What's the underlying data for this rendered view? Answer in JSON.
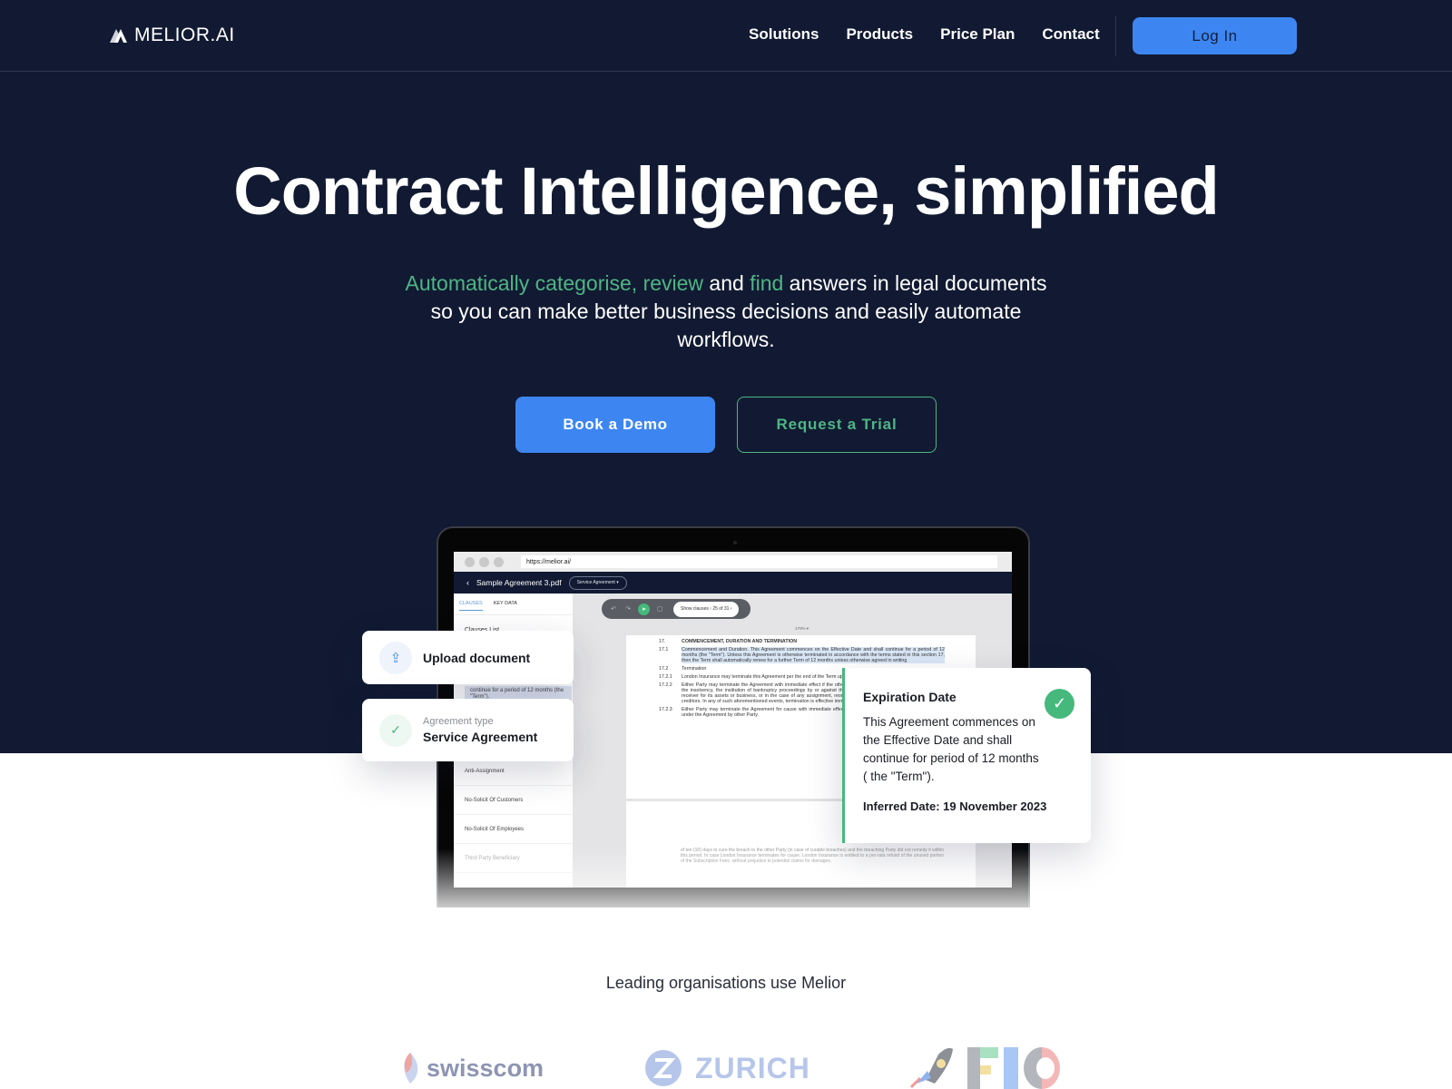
{
  "nav": {
    "brand": "MELIOR.AI",
    "links": [
      "Solutions",
      "Products",
      "Price Plan",
      "Contact"
    ],
    "login_label": "Log In"
  },
  "hero": {
    "title": "Contract Intelligence, simplified",
    "subtitle": {
      "hl1": "Automatically categorise, review",
      "t1": " and ",
      "hl2": "find",
      "t2": " answers in legal documents so you can make better business decisions and easily automate workflows."
    },
    "primary_cta": "Book a Demo",
    "secondary_cta": "Request a Trial"
  },
  "mockup": {
    "url": "https://melior.ai/",
    "doc_name": "Sample Agreement 3.pdf",
    "agreement_select": "Service Agreement",
    "tabs": [
      "CLAUSES",
      "KEY DATA"
    ],
    "clauses_heading": "Clauses List",
    "clause_snippet": "continue for a period of 12 months (the \"Term\").",
    "clauses": [
      "Anti-Assignment",
      "No-Solicit Of Customers",
      "No-Solicit Of Employees",
      "Third Party Beneficiary"
    ],
    "toolbar": {
      "show_clauses": "Show clauses",
      "counter": "25 of 31"
    },
    "zoom_level": "170% ▾",
    "document": [
      {
        "num": "17.",
        "text": "COMMENCEMENT, DURATION AND TERMINATION",
        "bold": true
      },
      {
        "num": "17.1",
        "text": "Commencement and Duration. This Agreement commences on the Effective Date and shall continue for a period of 12 months (the \"Term\"). Unless this Agreement is otherwise terminated in accordance with the terms stated in this section 17, then the Term shall automatically renew for a further Term of 12 months unless otherwise agreed in writing",
        "highlight": true
      },
      {
        "num": "17.2",
        "text": "Termination"
      },
      {
        "num": "17.2.1",
        "text": "London Insurance may terminate this Agreement per the end of the Term upon 30 day notice period."
      },
      {
        "num": "17.2.2",
        "text": "Either Party may terminate the Agreement with immediate effect if the other Party ceases its business by the other Party, the insolvency, the institution of bankruptcy proceedings by or against the other Party, the appointment of a trustee or receiver for its assets or business, or in the case of any assignment, reorganization or arrangement for the benefit of its creditors. In any of such aforementioned events, termination is effective immediately."
      },
      {
        "num": "17.2.3",
        "text": "Either Party may terminate the Agreement for cause with immediate effect in case of a material breach of an obligation under the Agreement by other Party."
      }
    ],
    "footer_text": "of ten (10) days to cure the breach to the other Party (in case of curable breaches) and the breaching Party did not remedy it within this period. In case London Insurance terminates for cause, London Insurance is entitled to a pro-rata refund of the unused portion of the Subscription Fees, without prejudice to potential claims for damages."
  },
  "cards": {
    "upload_label": "Upload document",
    "agreement_type_label": "Agreement type",
    "agreement_type_value": "Service Agreement",
    "expiration": {
      "title": "Expiration Date",
      "body": "This Agreement commences on the Effective Date and shall continue for period of 12 months ( the \"Term\").",
      "inferred": "Inferred Date: 19 November 2023"
    }
  },
  "clients": {
    "heading": "Leading organisations use Melior",
    "logos": [
      "swisscom",
      "ZURICH",
      "FIO"
    ]
  },
  "colors": {
    "background_dark": "#111a32",
    "accent_blue": "#3d86f2",
    "accent_green": "#4fb584"
  }
}
